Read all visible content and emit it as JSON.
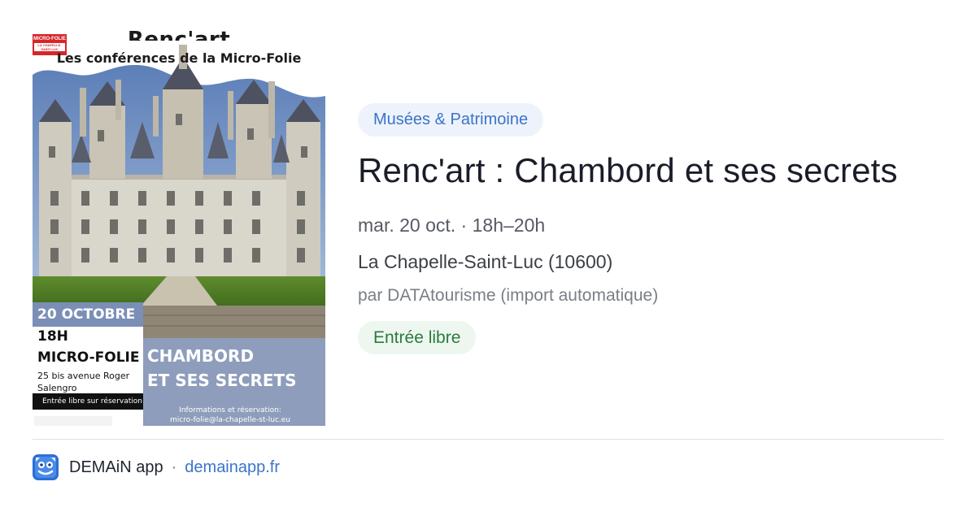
{
  "poster": {
    "logo_text": "MICRO-FOLIE",
    "logo_sub": "LA CHAPELLE-SAINT-LUC",
    "title": "Renc'art",
    "subtitle": "Les conférences de la Micro-Folie",
    "date": "20 OCTOBRE",
    "time": "18H",
    "venue": "MICRO-FOLIE",
    "address_line1": "25 bis avenue Roger",
    "address_line2": "Salengro",
    "reservation": "Entrée libre sur réservation",
    "headline_line1": "CHAMBORD",
    "headline_line2": "ET SES SECRETS",
    "info_line1": "Informations et réservation:",
    "info_line2": "micro-folie@la-chapelle-st-luc.eu"
  },
  "event": {
    "category": "Musées & Patrimoine",
    "title": "Renc'art : Chambord et ses secrets",
    "date": "mar. 20 oct. · 18h–20h",
    "location": "La Chapelle-Saint-Luc (10600)",
    "source": "par DATAtourisme (import automatique)",
    "price": "Entrée libre"
  },
  "footer": {
    "app_name": "DEMAiN app",
    "separator": "·",
    "link": "demainapp.fr"
  },
  "colors": {
    "category_text": "#3a74c9",
    "category_bg": "#eef3fb",
    "price_text": "#2b7a3f",
    "price_bg": "#edf7ef",
    "link": "#3a74c9",
    "app_icon": "#2b6fd6"
  },
  "icons": {
    "app": "demain-app-icon"
  }
}
